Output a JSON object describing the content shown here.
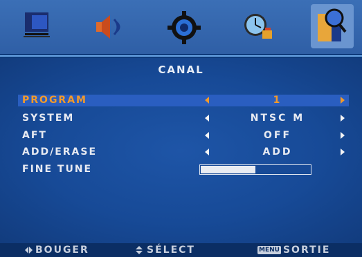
{
  "top_icons": [
    {
      "name": "picture-icon",
      "active": false
    },
    {
      "name": "speaker-icon",
      "active": false
    },
    {
      "name": "gear-icon",
      "active": false
    },
    {
      "name": "clock-icon",
      "active": false
    },
    {
      "name": "channel-search-icon",
      "active": true
    }
  ],
  "menu": {
    "title": "CANAL",
    "rows": [
      {
        "label": "PROGRAM",
        "value": "1",
        "selected": true
      },
      {
        "label": "SYSTEM",
        "value": "NTSC M",
        "selected": false
      },
      {
        "label": "AFT",
        "value": "OFF",
        "selected": false
      },
      {
        "label": "ADD/ERASE",
        "value": "ADD",
        "selected": false
      }
    ],
    "fine_tune": {
      "label": "FINE TUNE",
      "level": 0.5
    }
  },
  "footer": {
    "move_label": "BOUGER",
    "select_label": "SÉLECT",
    "menu_badge": "MENU",
    "exit_label": "SORTIE"
  },
  "colors": {
    "selected_text": "#f39a2a",
    "normal_text": "#e7eaf2",
    "highlight_bar": "#2a5ec0",
    "panel_bg": "#174a97"
  }
}
